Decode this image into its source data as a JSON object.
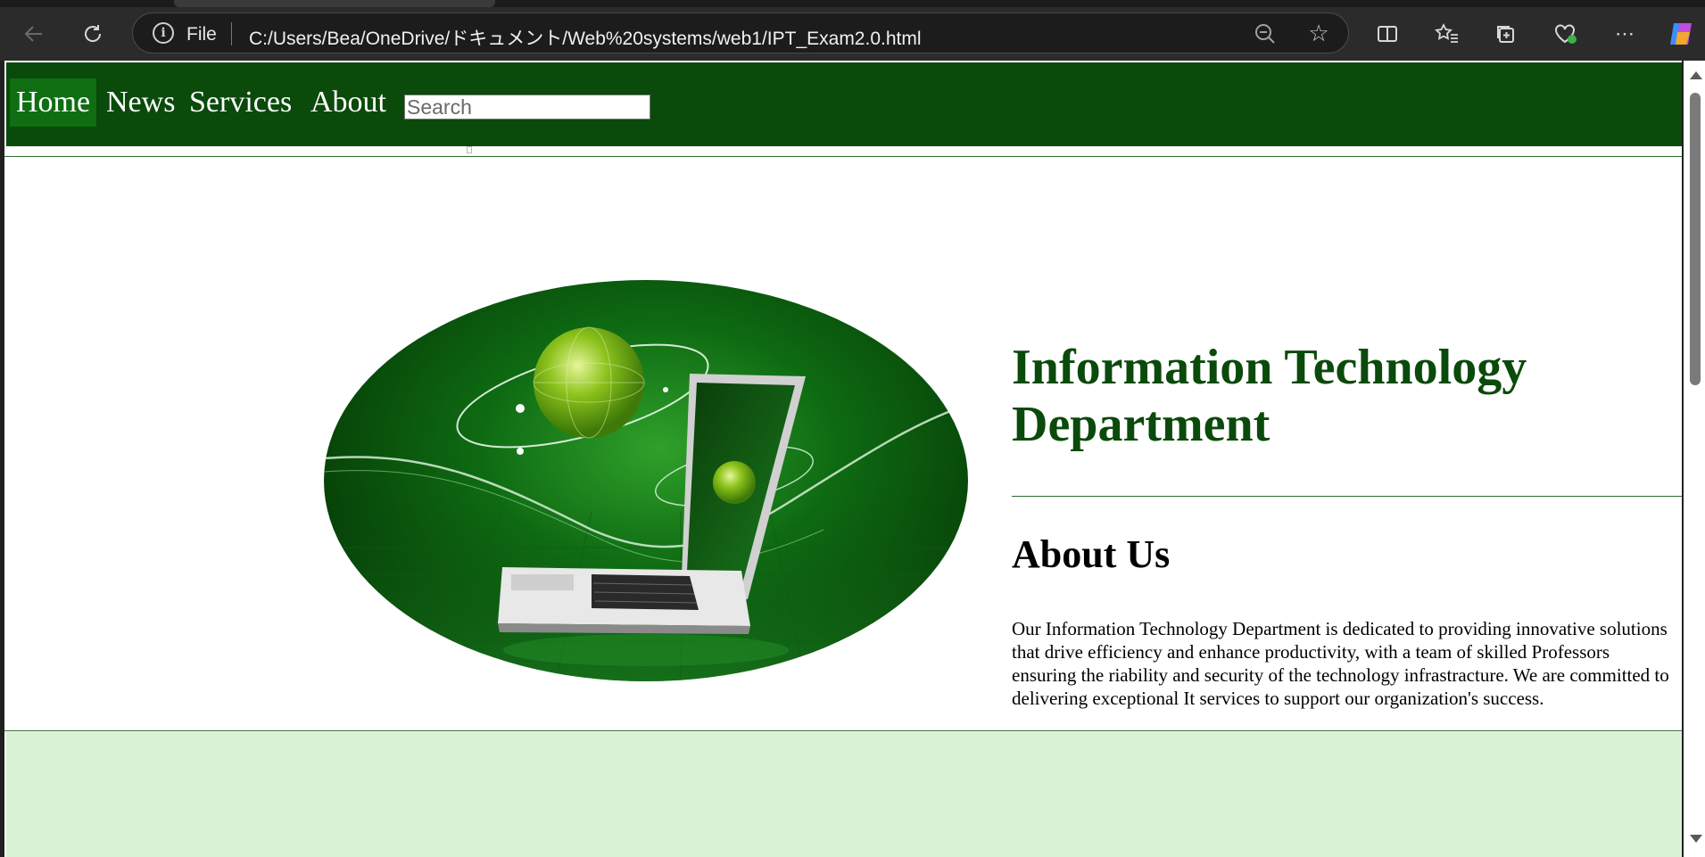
{
  "browser": {
    "address_prefix": "File",
    "url": "C:/Users/Bea/OneDrive/ドキュメント/Web%20systems/web1/IPT_Exam2.0.html"
  },
  "nav": {
    "items": [
      {
        "label": "Home"
      },
      {
        "label": "News"
      },
      {
        "label": "Services"
      },
      {
        "label": "About"
      }
    ],
    "search_placeholder": "Search"
  },
  "hero": {
    "title": "Information Technology Department"
  },
  "about": {
    "heading": "About Us",
    "body": "Our Information Technology Department is dedicated to providing innovative solutions that drive efficiency and enhance productivity, with a team of skilled Professors ensuring the riability and security of the technology infrastracture. We are committed to delivering exceptional It services to support our organization's success."
  },
  "colors": {
    "nav_bg": "#0a4a0b",
    "nav_active": "#0f6e12",
    "title_color": "#0a4a0b",
    "footer_bg": "#d9f2d4"
  }
}
